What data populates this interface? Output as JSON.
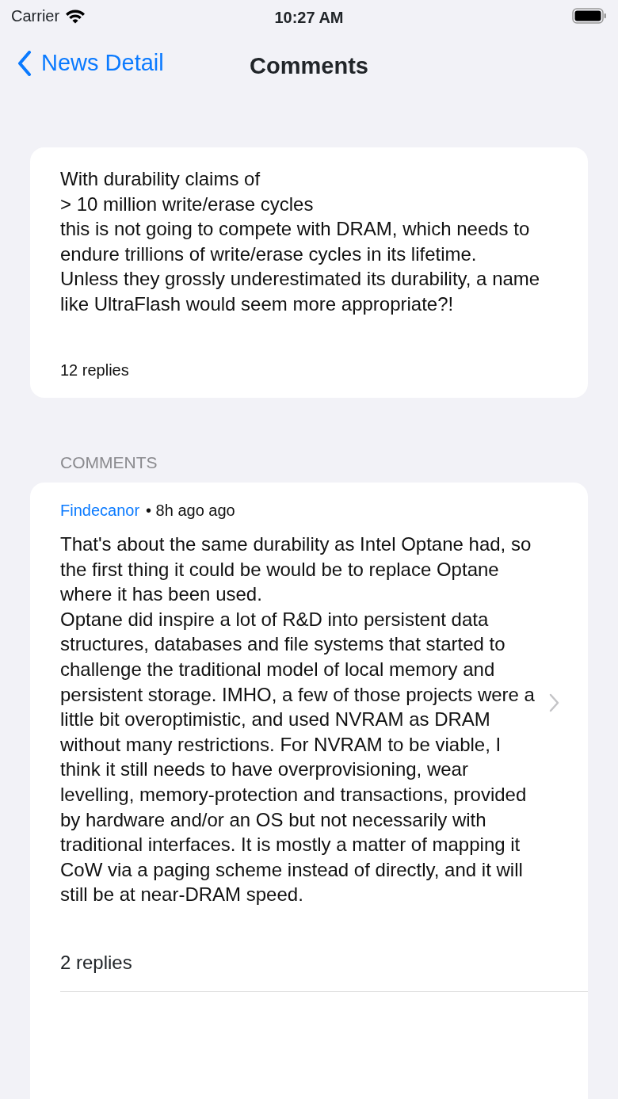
{
  "status_bar": {
    "carrier": "Carrier",
    "time": "10:27 AM"
  },
  "nav": {
    "back_label": "News Detail",
    "title": "Comments"
  },
  "post": {
    "text": "With durability claims of\n> 10 million write/erase cycles\nthis is not going to compete with DRAM, which needs to endure trillions of write/erase cycles in its lifetime.\nUnless they grossly underestimated its durability, a name like UltraFlash would seem more appropriate?!",
    "replies": "12 replies"
  },
  "section_header": "COMMENTS",
  "comments": [
    {
      "author": "Findecanor",
      "meta": "• 8h ago ago",
      "text": "That's about the same durability as Intel Optane had, so the first thing it could be would be to replace Optane where it has been used.\nOptane did inspire a lot of R&D into persistent data structures, databases and file systems that started to challenge the traditional model of local memory and persistent storage. IMHO, a few of those projects were a little bit overoptimistic, and used NVRAM as DRAM without many restrictions. For NVRAM to be viable, I think it still needs to have overprovisioning, wear levelling, memory-protection and transactions, provided by hardware and/or an OS but not necessarily with traditional interfaces. It is mostly a matter of mapping it CoW via a paging scheme instead of directly, and it will still be at near-DRAM speed.",
      "replies": "2 replies"
    }
  ]
}
